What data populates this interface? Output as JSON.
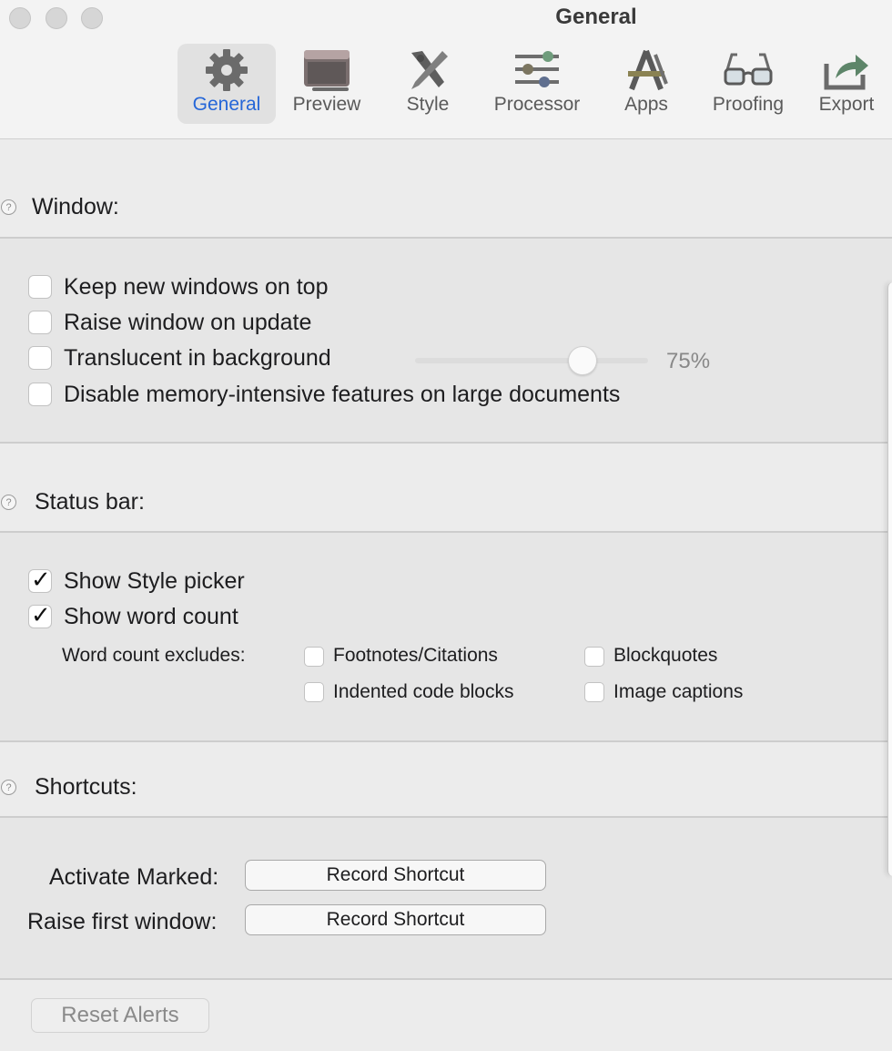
{
  "window": {
    "title": "General"
  },
  "toolbar": {
    "tabs": [
      {
        "label": "General",
        "icon": "gear-icon",
        "selected": true
      },
      {
        "label": "Preview",
        "icon": "preview-window-icon",
        "selected": false
      },
      {
        "label": "Style",
        "icon": "style-brush-icon",
        "selected": false
      },
      {
        "label": "Processor",
        "icon": "sliders-icon",
        "selected": false
      },
      {
        "label": "Apps",
        "icon": "apps-a-icon",
        "selected": false
      },
      {
        "label": "Proofing",
        "icon": "glasses-icon",
        "selected": false
      },
      {
        "label": "Export",
        "icon": "export-arrow-icon",
        "selected": false
      }
    ]
  },
  "window_section": {
    "title": "Window:",
    "options": [
      {
        "label": "Keep new windows on top",
        "checked": false
      },
      {
        "label": "Raise window on update",
        "checked": false
      },
      {
        "label": "Translucent in background",
        "checked": false
      },
      {
        "label": "Disable memory-intensive features on large documents",
        "checked": false
      }
    ],
    "translucency": {
      "value_percent": 75,
      "value_label": "75%"
    }
  },
  "status_section": {
    "title": "Status bar:",
    "options": [
      {
        "label": "Show Style picker",
        "checked": true
      },
      {
        "label": "Show word count",
        "checked": true
      }
    ],
    "excludes_label": "Word count excludes:",
    "excludes": [
      {
        "label": "Footnotes/Citations",
        "checked": false
      },
      {
        "label": "Blockquotes",
        "checked": false
      },
      {
        "label": "Indented code blocks",
        "checked": false
      },
      {
        "label": "Image captions",
        "checked": false
      }
    ]
  },
  "shortcuts_section": {
    "title": "Shortcuts:",
    "rows": [
      {
        "label": "Activate Marked:",
        "button": "Record Shortcut"
      },
      {
        "label": "Raise first window:",
        "button": "Record Shortcut"
      }
    ]
  },
  "footer": {
    "reset_label": "Reset Alerts"
  },
  "colors": {
    "accent": "#2566d8",
    "background": "#ececec"
  }
}
